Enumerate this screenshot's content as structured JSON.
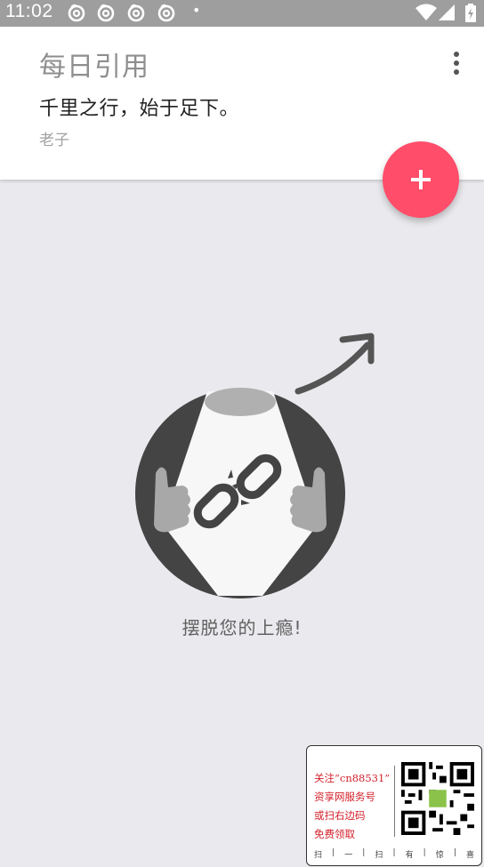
{
  "status_bar": {
    "time": "11:02",
    "notification_icons": [
      "netease-music-icon",
      "netease-music-icon",
      "netease-music-icon",
      "netease-music-icon"
    ],
    "more_dot": "•"
  },
  "card": {
    "title": "每日引用",
    "quote": "千里之行，始于足下。",
    "author": "老子"
  },
  "empty_state": {
    "message": "摆脱您的上瘾!"
  },
  "ad": {
    "lines": [
      "关注“cn88531”",
      "资享网服务号",
      "或扫右边码",
      "免费领取"
    ],
    "footer": [
      "扫",
      "|",
      "一",
      "|",
      "扫",
      "|",
      "有",
      "|",
      "惊",
      "|",
      "喜"
    ]
  },
  "colors": {
    "status_bar": "#9e9e9e",
    "fab": "#ff4d6a",
    "background": "#eaeaee",
    "ad_text": "#d21f2a"
  }
}
